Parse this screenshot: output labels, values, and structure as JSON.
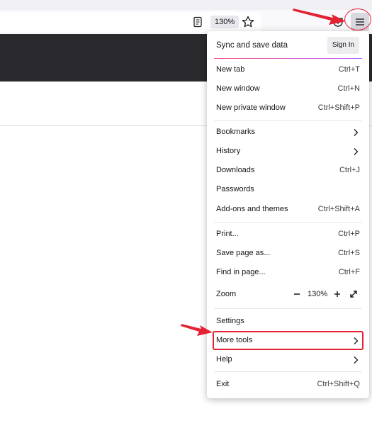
{
  "toolbar": {
    "zoom_level": "130%",
    "icons": [
      "reader-view-icon",
      "bookmark-star-icon",
      "pocket-icon",
      "hamburger-menu-icon"
    ]
  },
  "menu": {
    "sync": {
      "title": "Sync and save data",
      "signin_label": "Sign In"
    },
    "group1": [
      {
        "label": "New tab",
        "shortcut": "Ctrl+T"
      },
      {
        "label": "New window",
        "shortcut": "Ctrl+N"
      },
      {
        "label": "New private window",
        "shortcut": "Ctrl+Shift+P"
      }
    ],
    "group2": [
      {
        "label": "Bookmarks"
      },
      {
        "label": "History"
      },
      {
        "label": "Downloads",
        "shortcut": "Ctrl+J"
      },
      {
        "label": "Passwords"
      },
      {
        "label": "Add-ons and themes",
        "shortcut": "Ctrl+Shift+A"
      }
    ],
    "group3": [
      {
        "label": "Print...",
        "shortcut": "Ctrl+P"
      },
      {
        "label": "Save page as...",
        "shortcut": "Ctrl+S"
      },
      {
        "label": "Find in page...",
        "shortcut": "Ctrl+F"
      }
    ],
    "zoom": {
      "label": "Zoom",
      "value": "130%"
    },
    "group4": [
      {
        "label": "Settings"
      },
      {
        "label": "More tools"
      },
      {
        "label": "Help"
      }
    ],
    "exit": {
      "label": "Exit",
      "shortcut": "Ctrl+Shift+Q"
    }
  },
  "colors": {
    "annotation_red": "#e32333",
    "menu_bg": "#ffffff",
    "toolbar_bg": "#f9f9fb",
    "page_dark": "#2a2a2e"
  }
}
